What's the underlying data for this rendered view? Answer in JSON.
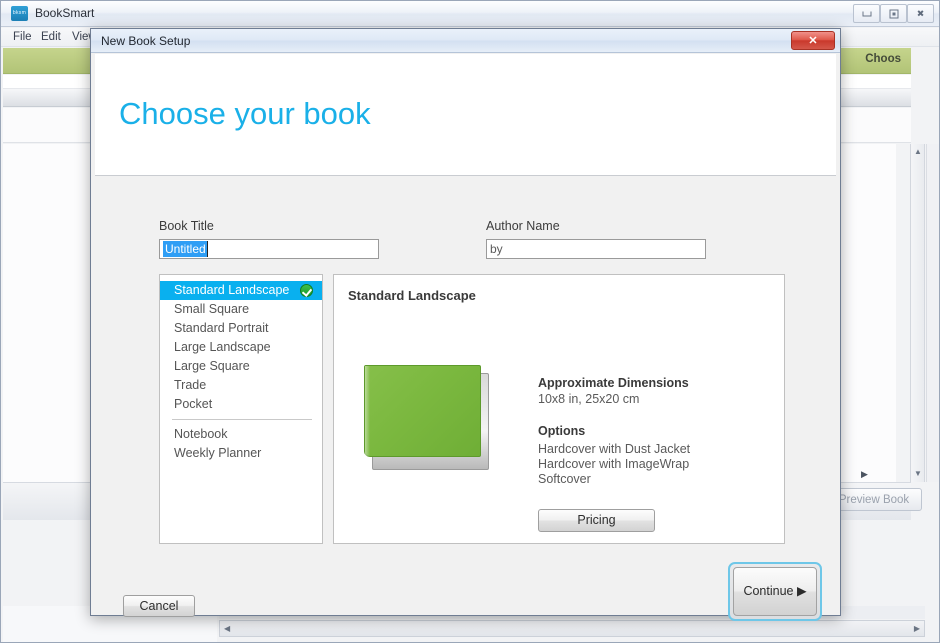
{
  "app": {
    "title": "BookSmart",
    "logo_text": "bksm",
    "menus": [
      "File",
      "Edit",
      "View"
    ],
    "green_bar_label": "Choos",
    "preview_button": "Preview Book",
    "window_buttons": {
      "minimize": "minimize-icon",
      "maximize": "maximize-icon",
      "close": "close-icon"
    },
    "scroll": {
      "up": "▲",
      "down": "▼",
      "left": "◀",
      "right": "▶"
    }
  },
  "dialog": {
    "title": "New Book Setup",
    "close_label": "✕",
    "heading": "Choose your book",
    "form": {
      "book_title_label": "Book Title",
      "book_title_value": "Untitled",
      "author_name_label": "Author Name",
      "author_name_value": "by"
    },
    "book_types": [
      {
        "label": "Standard Landscape",
        "selected": true
      },
      {
        "label": "Small Square",
        "selected": false
      },
      {
        "label": "Standard Portrait",
        "selected": false
      },
      {
        "label": "Large Landscape",
        "selected": false
      },
      {
        "label": "Large Square",
        "selected": false
      },
      {
        "label": "Trade",
        "selected": false
      },
      {
        "label": "Pocket",
        "selected": false
      }
    ],
    "book_types_secondary": [
      {
        "label": "Notebook",
        "selected": false
      },
      {
        "label": "Weekly Planner",
        "selected": false
      }
    ],
    "detail": {
      "title": "Standard Landscape",
      "dimensions_heading": "Approximate Dimensions",
      "dimensions_value": "10x8 in, 25x20 cm",
      "options_heading": "Options",
      "options": [
        "Hardcover with Dust Jacket",
        "Hardcover with ImageWrap",
        "Softcover"
      ],
      "pricing_button": "Pricing",
      "cover_color": "#7bb83f"
    },
    "footer": {
      "cancel_button": "Cancel",
      "continue_button": "Continue ▶"
    },
    "accent_color": "#1ab0e8",
    "selection_color": "#09b0ef"
  }
}
